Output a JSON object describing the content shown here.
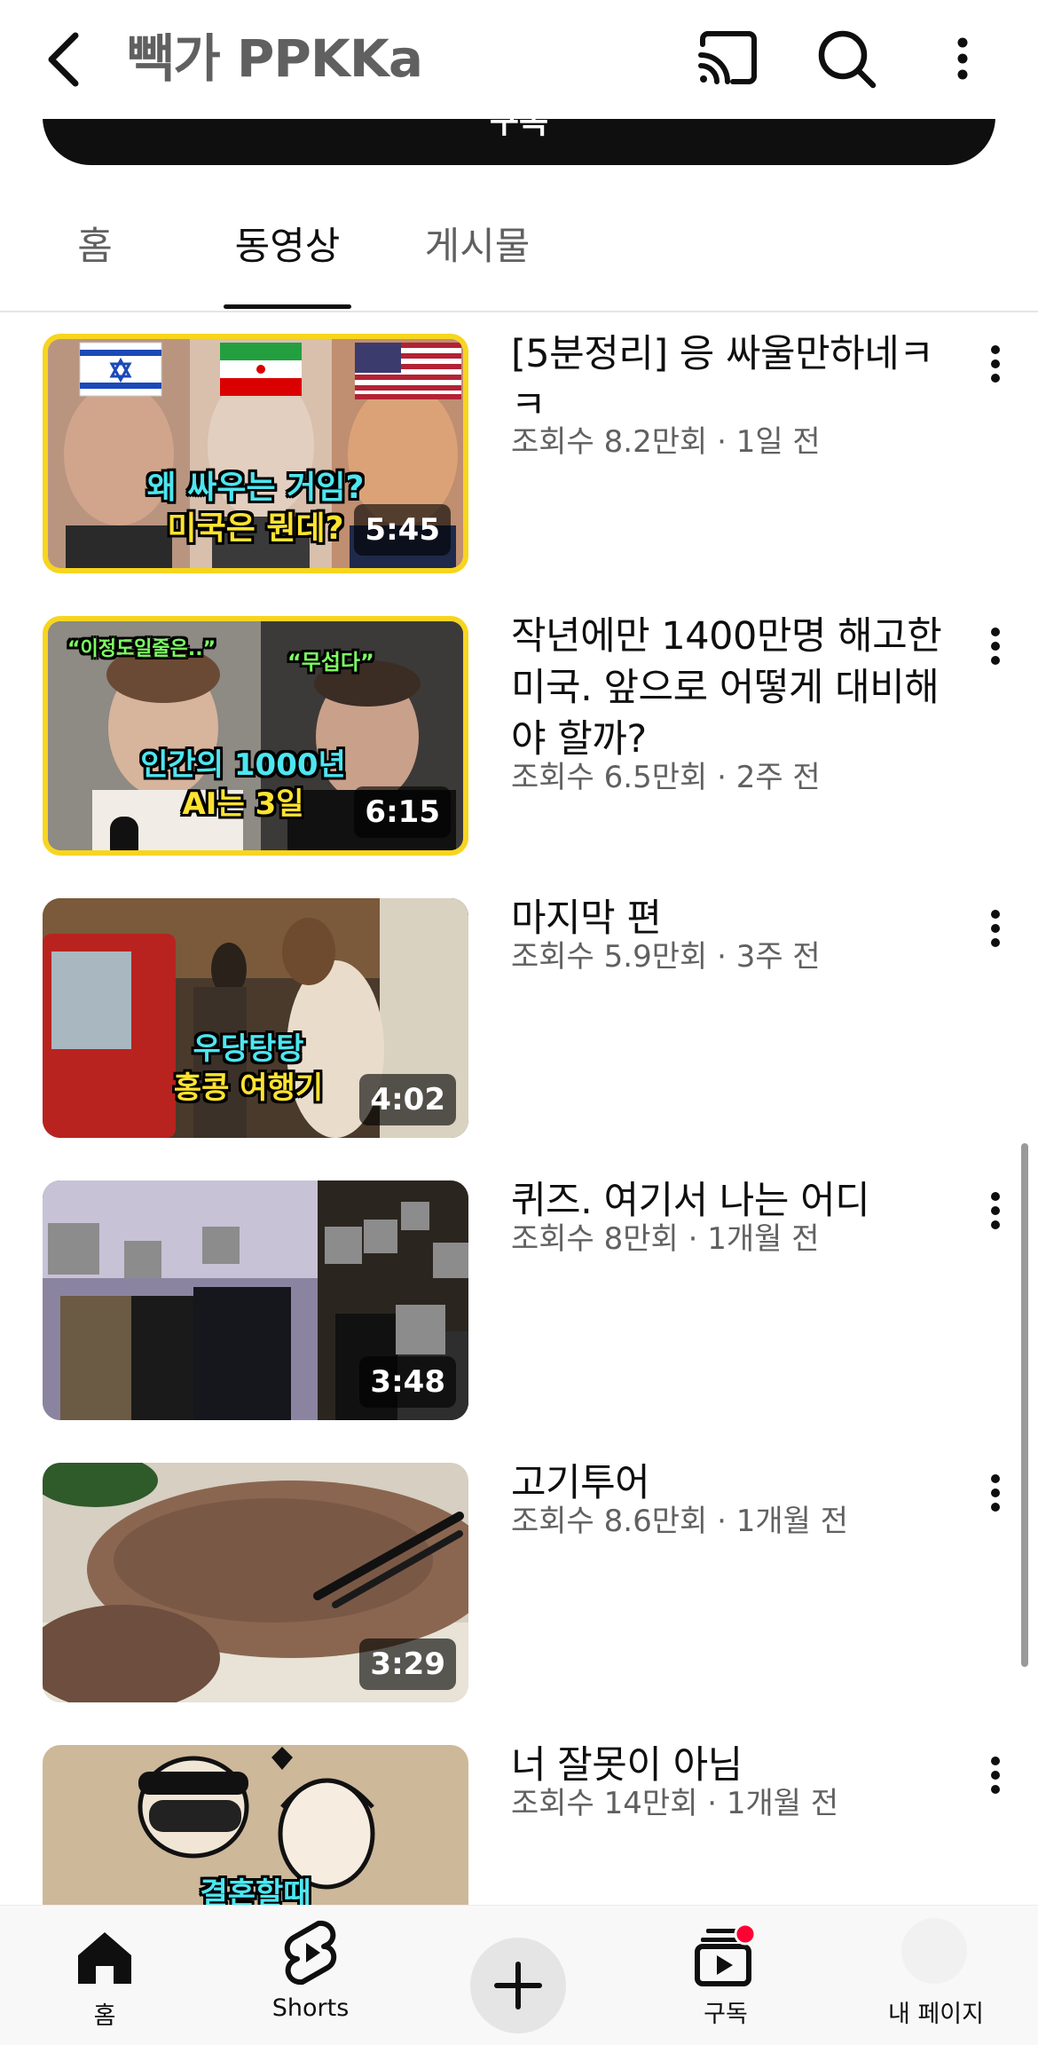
{
  "header": {
    "channel_title": "빽가 PPKKa",
    "subscribe_label": "구독"
  },
  "tabs": [
    {
      "label": "홈",
      "active": false
    },
    {
      "label": "동영상",
      "active": true
    },
    {
      "label": "게시물",
      "active": false
    }
  ],
  "videos": [
    {
      "title": "[5분정리] 응 싸울만하네ㅋㅋ",
      "meta": "조회수 8.2만회 · 1일 전",
      "duration": "5:45",
      "thumb_text": [
        "왜 싸우는 거임?",
        "미국은 뭔데?"
      ]
    },
    {
      "title": "작년에만 1400만명 해고한 미국. 앞으로 어떻게 대비해야 할까?",
      "meta": "조회수 6.5만회 · 2주 전",
      "duration": "6:15",
      "thumb_text": [
        "“이정도일줄은..”",
        "“무섭다”",
        "인간의 1000년",
        "AI는 3일"
      ]
    },
    {
      "title": "마지막 편",
      "meta": "조회수 5.9만회 · 3주 전",
      "duration": "4:02",
      "thumb_text": [
        "우당탕탕",
        "홍콩 여행기"
      ]
    },
    {
      "title": "퀴즈. 여기서 나는 어디",
      "meta": "조회수 8만회 · 1개월 전",
      "duration": "3:48"
    },
    {
      "title": "고기투어",
      "meta": "조회수 8.6만회 · 1개월 전",
      "duration": "3:29"
    },
    {
      "title": "너 잘못이 아님",
      "meta": "조회수 14만회 · 1개월 전",
      "thumb_text": [
        "결혼할때"
      ]
    }
  ],
  "bottom_nav": {
    "home": "홈",
    "shorts": "Shorts",
    "subscriptions": "구독",
    "my_page": "내 페이지"
  },
  "colors": {
    "thumb_frame": "#f7d51e",
    "notification_dot": "#ff0033",
    "text_primary": "#0f0f0f",
    "text_secondary": "#606060"
  },
  "icons": [
    "back-arrow-icon",
    "cast-icon",
    "search-icon",
    "more-vert-icon",
    "home-icon",
    "shorts-icon",
    "plus-icon",
    "subscriptions-icon"
  ]
}
